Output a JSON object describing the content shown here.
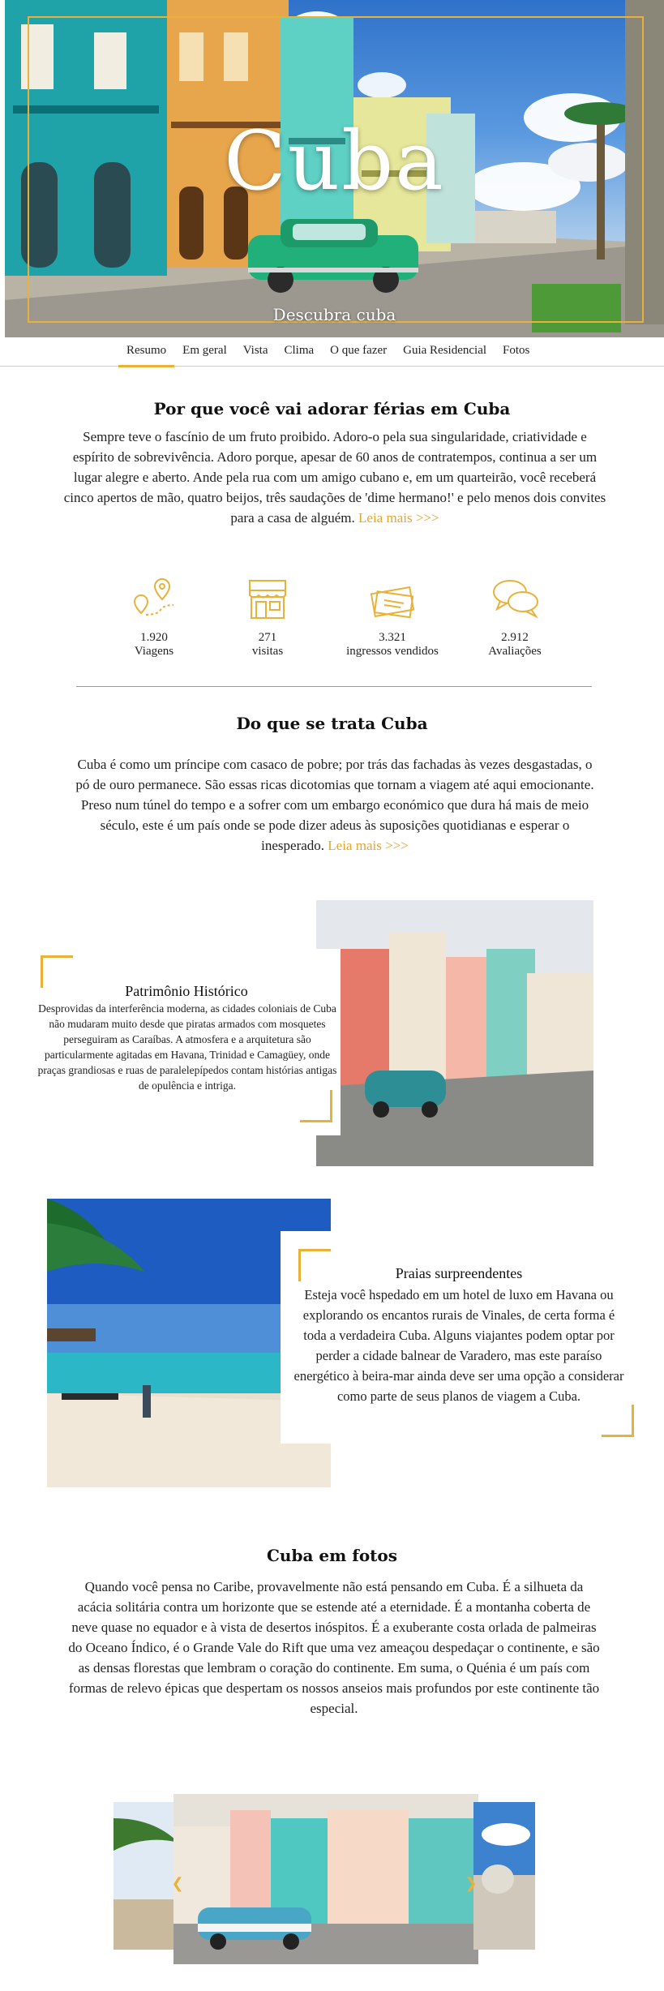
{
  "hero": {
    "title": "Cuba",
    "subtitle": "Descubra cuba"
  },
  "nav": {
    "items": [
      {
        "label": "Resumo",
        "active": true
      },
      {
        "label": "Em geral",
        "active": false
      },
      {
        "label": "Vista",
        "active": false
      },
      {
        "label": "Clima",
        "active": false
      },
      {
        "label": "O que fazer",
        "active": false
      },
      {
        "label": "Guia Residencial",
        "active": false
      },
      {
        "label": "Fotos",
        "active": false
      }
    ]
  },
  "why": {
    "heading": "Por que você vai adorar férias em Cuba",
    "text": "Sempre teve o fascínio de um fruto proibido. Adoro-o pela sua singularidade, criatividade e espírito de sobrevivência. Adoro porque, apesar de 60 anos de contratempos, continua a ser um lugar alegre e aberto. Ande pela rua com um amigo cubano e, em um quarteirão, você receberá cinco apertos de mão, quatro beijos, três saudações de 'dime hermano!' e pelo menos dois convites para a casa de alguém.",
    "more": "Leia mais >>>"
  },
  "stats": [
    {
      "icon": "map-pin-route-icon",
      "value": "1.920",
      "label": "Viagens"
    },
    {
      "icon": "storefront-icon",
      "value": "271",
      "label": "visitas"
    },
    {
      "icon": "tickets-icon",
      "value": "3.321",
      "label": "ingressos vendidos"
    },
    {
      "icon": "chat-bubbles-icon",
      "value": "2.912",
      "label": "Avaliações"
    }
  ],
  "about": {
    "heading": "Do que se trata Cuba",
    "text": "Cuba é como um príncipe com casaco de pobre; por trás das fachadas às vezes desgastadas, o pó de ouro permanece. São essas ricas dicotomias que tornam a viagem até aqui emocionante. Preso num túnel do tempo e a sofrer com um embargo económico que dura há mais de meio século, este é um país onde se pode dizer adeus às suposições quotidianas e esperar o inesperado.",
    "more": "Leia mais >>>"
  },
  "heritage": {
    "title": "Patrimônio Histórico",
    "text": "Desprovidas da interferência moderna, as cidades coloniais de Cuba não mudaram muito desde que piratas armados com mosquetes perseguiram as Caraíbas. A atmosfera e a arquitetura são particularmente agitadas em Havana, Trinidad e Camagüey, onde praças grandiosas e ruas de paralelepípedos contam histórias antigas de opulência e intriga."
  },
  "beaches": {
    "title": "Praias surpreendentes",
    "text": "Esteja você hspedado em um hotel de luxo em Havana ou explorando os encantos rurais de Vinales, de certa forma é toda a verdadeira Cuba. Alguns viajantes podem optar por perder a cidade balnear de Varadero, mas este paraíso energético à beira-mar ainda deve ser uma opção a considerar como parte de seus planos de viagem a Cuba."
  },
  "photos": {
    "heading": "Cuba em fotos",
    "text": "Quando você pensa no Caribe, provavelmente não está pensando em Cuba. É a silhueta da acácia solitária contra um horizonte que se estende até a eternidade. É a montanha coberta de neve quase no equador e à vista de desertos inóspitos. É a exuberante costa orlada de palmeiras do Oceano Índico, é o Grande Vale do Rift que uma vez ameaçou despedaçar o continente, e são as densas florestas que lembram o coração do continente. Em suma, o Quénia é um país com formas de relevo épicas que despertam os nossos anseios mais profundos por este continente tão especial."
  },
  "colors": {
    "accent": "#e8b23a",
    "link": "#e8a52a"
  }
}
